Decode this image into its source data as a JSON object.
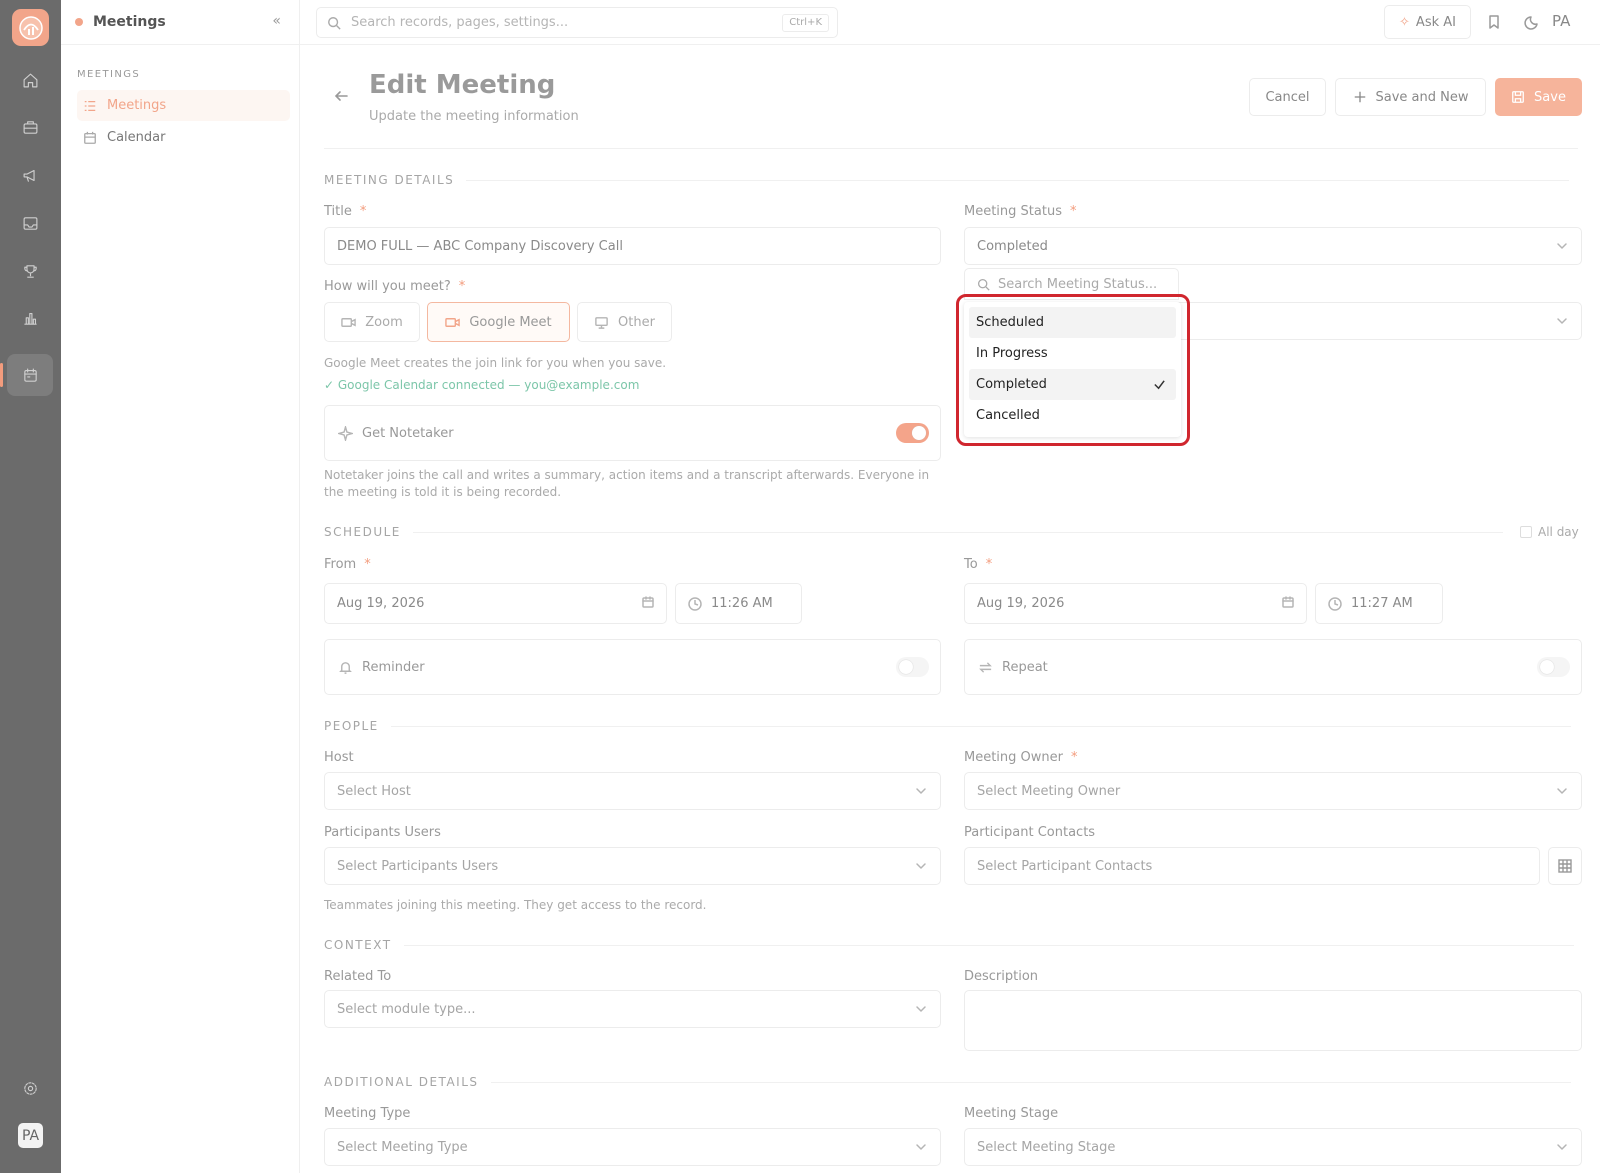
{
  "sidebar": {
    "app_title": "Meetings",
    "section_label": "MEETINGS",
    "items": [
      {
        "label": "Meetings",
        "active": true
      },
      {
        "label": "Calendar",
        "active": false
      }
    ],
    "avatar_initials": "PA"
  },
  "topbar": {
    "search_placeholder": "Search records, pages, settings...",
    "search_shortcut": "Ctrl+K",
    "ask_ai_label": "Ask AI",
    "user_initials": "PA"
  },
  "header": {
    "title": "Edit Meeting",
    "subtitle": "Update the meeting information",
    "cancel_label": "Cancel",
    "save_new_label": "Save and New",
    "save_label": "Save"
  },
  "meeting_details": {
    "section_title": "MEETING DETAILS",
    "title_label": "Title",
    "title_value": "DEMO FULL — ABC Company Discovery Call",
    "how_label": "How will you meet?",
    "options": [
      "Zoom",
      "Google Meet",
      "Other"
    ],
    "selected_option": "Google Meet",
    "gm_hint": "Google Meet creates the join link for you when you save.",
    "gm_connected": "Google Calendar connected — you@example.com",
    "notetaker_label": "Get Notetaker",
    "notetaker_on": true,
    "notetaker_hint": "Notetaker joins the call and writes a summary, action items and a transcript afterwards. Everyone in the meeting is told it is being recorded.",
    "status_label": "Meeting Status",
    "status_value": "Completed",
    "status_search_placeholder": "Search Meeting Status...",
    "status_options": [
      "Scheduled",
      "In Progress",
      "Completed",
      "Cancelled"
    ],
    "status_selected": "Completed"
  },
  "schedule": {
    "section_title": "SCHEDULE",
    "all_day_label": "All day",
    "from_label": "From",
    "from_date": "Aug 19, 2026",
    "from_time": "11:26 AM",
    "to_label": "To",
    "to_date": "Aug 19, 2026",
    "to_time": "11:27 AM",
    "reminder_label": "Reminder",
    "repeat_label": "Repeat"
  },
  "people": {
    "section_title": "PEOPLE",
    "host_label": "Host",
    "host_placeholder": "Select Host",
    "owner_label": "Meeting Owner",
    "owner_placeholder": "Select Meeting Owner",
    "participants_users_label": "Participants Users",
    "participants_users_placeholder": "Select Participants Users",
    "participant_contacts_label": "Participant Contacts",
    "participant_contacts_placeholder": "Select Participant Contacts",
    "participants_hint": "Teammates joining this meeting. They get access to the record."
  },
  "context": {
    "section_title": "CONTEXT",
    "related_label": "Related To",
    "related_placeholder": "Select module type...",
    "description_label": "Description"
  },
  "additional": {
    "section_title": "ADDITIONAL DETAILS",
    "type_label": "Meeting Type",
    "type_placeholder": "Select Meeting Type",
    "stage_label": "Meeting Stage",
    "stage_placeholder": "Select Meeting Stage"
  },
  "colors": {
    "accent": "#f2a58a",
    "rail": "#6b6b6b",
    "highlight": "#d0262e",
    "connected": "#7cc6a9"
  }
}
